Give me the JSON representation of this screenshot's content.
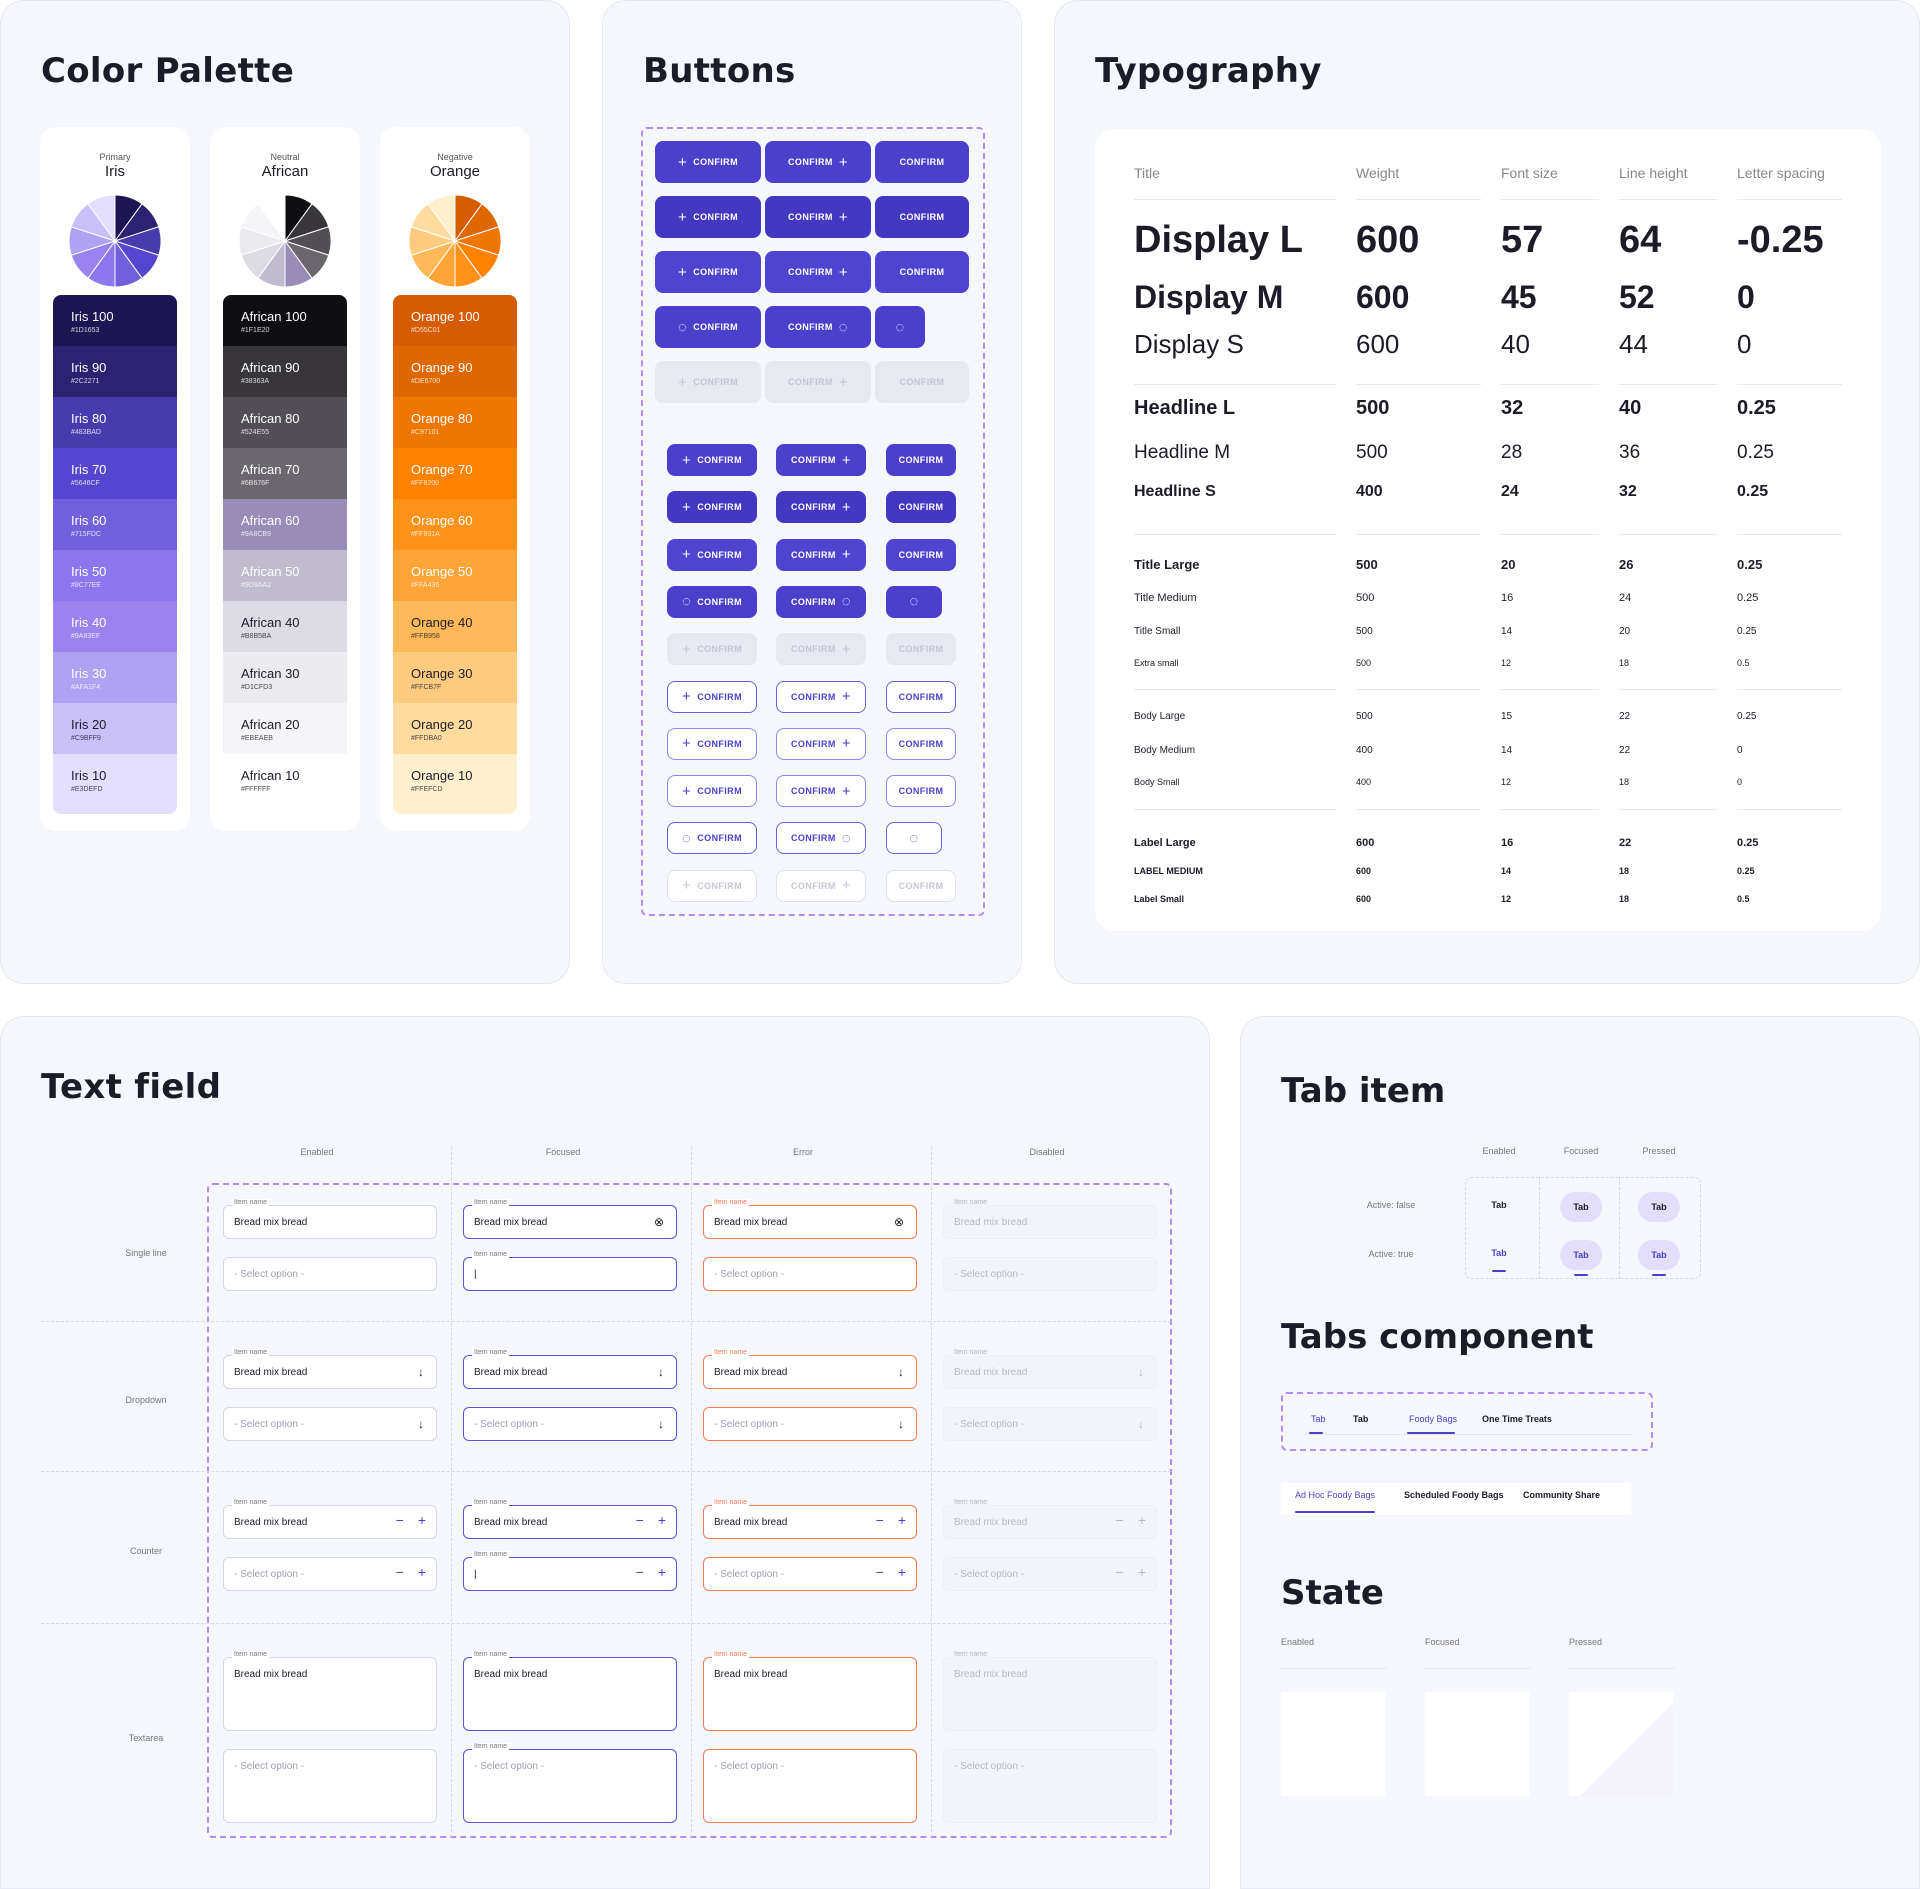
{
  "colors": {
    "accent": "#4b3fcc",
    "error": "#f27c57",
    "disabled": "#e8e8f0",
    "border_dashed": "#b68cf0"
  },
  "palette": {
    "title": "Color Palette",
    "groups": [
      {
        "sub": "Primary",
        "name": "Iris",
        "swatches": [
          {
            "label": "Iris 100",
            "hex": "#1D1653",
            "bg": "#1d1653",
            "fg": "#fff"
          },
          {
            "label": "Iris 90",
            "hex": "#2C2271",
            "bg": "#2c2271",
            "fg": "#fff"
          },
          {
            "label": "Iris 80",
            "hex": "#483BAD",
            "bg": "#483bad",
            "fg": "#fff"
          },
          {
            "label": "Iris 70",
            "hex": "#5646CF",
            "bg": "#5646cf",
            "fg": "#fff"
          },
          {
            "label": "Iris 60",
            "hex": "#715FDC",
            "bg": "#715fdc",
            "fg": "#fff"
          },
          {
            "label": "Iris 50",
            "hex": "#8C77EE",
            "bg": "#8c77ee",
            "fg": "#fff"
          },
          {
            "label": "Iris 40",
            "hex": "#9A83EF",
            "bg": "#9a83ef",
            "fg": "#fff"
          },
          {
            "label": "Iris 30",
            "hex": "#AFA1F4",
            "bg": "#afa1f4",
            "fg": "#fff"
          },
          {
            "label": "Iris 20",
            "hex": "#C9BFF9",
            "bg": "#c9bff9",
            "fg": "#1c1c28"
          },
          {
            "label": "Iris 10",
            "hex": "#E3DEFD",
            "bg": "#e3defd",
            "fg": "#1c1c28"
          }
        ]
      },
      {
        "sub": "Neutral",
        "name": "African",
        "swatches": [
          {
            "label": "African 100",
            "hex": "#1F1E20",
            "bg": "#0f0e12",
            "fg": "#fff"
          },
          {
            "label": "African 90",
            "hex": "#38363A",
            "bg": "#38363a",
            "fg": "#fff"
          },
          {
            "label": "African 80",
            "hex": "#524E55",
            "bg": "#524e55",
            "fg": "#fff"
          },
          {
            "label": "African 70",
            "hex": "#6B676F",
            "bg": "#6b676f",
            "fg": "#fff"
          },
          {
            "label": "African 60",
            "hex": "#9A8CB9",
            "bg": "#9a8cb9",
            "fg": "#fff"
          },
          {
            "label": "African 50",
            "hex": "#9D9AA2",
            "bg": "#c0bccd",
            "fg": "#fff"
          },
          {
            "label": "African 40",
            "hex": "#B8B5BA",
            "bg": "#dddbe3",
            "fg": "#1c1c28"
          },
          {
            "label": "African 30",
            "hex": "#D1CFD3",
            "bg": "#ebeaef",
            "fg": "#1c1c28"
          },
          {
            "label": "African 20",
            "hex": "#EBEAEB",
            "bg": "#f5f5f8",
            "fg": "#1c1c28"
          },
          {
            "label": "African 10",
            "hex": "#FFFFFF",
            "bg": "#ffffff",
            "fg": "#1c1c28"
          }
        ]
      },
      {
        "sub": "Negative",
        "name": "Orange",
        "swatches": [
          {
            "label": "Orange 100",
            "hex": "#D55C01",
            "bg": "#d55c01",
            "fg": "#fff"
          },
          {
            "label": "Orange 90",
            "hex": "#DE6700",
            "bg": "#de6700",
            "fg": "#fff"
          },
          {
            "label": "Orange 80",
            "hex": "#C97101",
            "bg": "#ef7601",
            "fg": "#fff"
          },
          {
            "label": "Orange 70",
            "hex": "#FF8200",
            "bg": "#ff8200",
            "fg": "#fff"
          },
          {
            "label": "Orange 60",
            "hex": "#FF931A",
            "bg": "#ff931a",
            "fg": "#fff"
          },
          {
            "label": "Orange 50",
            "hex": "#FFA436",
            "bg": "#ffa436",
            "fg": "#fff"
          },
          {
            "label": "Orange 40",
            "hex": "#FFB958",
            "bg": "#ffb958",
            "fg": "#1c1c28"
          },
          {
            "label": "Orange 30",
            "hex": "#FFCB7F",
            "bg": "#ffcb7f",
            "fg": "#1c1c28"
          },
          {
            "label": "Orange 20",
            "hex": "#FFDBA0",
            "bg": "#ffdba0",
            "fg": "#1c1c28"
          },
          {
            "label": "Orange 10",
            "hex": "#FFEFCD",
            "bg": "#ffefcd",
            "fg": "#1c1c28"
          }
        ]
      }
    ]
  },
  "buttons": {
    "title": "Buttons",
    "label": "CONFIRM",
    "plus_icon": "+",
    "spinner_icon": "spinner-icon"
  },
  "typography": {
    "title": "Typography",
    "headers": [
      "Title",
      "Weight",
      "Font size",
      "Line height",
      "Letter spacing"
    ],
    "rows": [
      {
        "name": "Display L",
        "weight": "600",
        "size": "57",
        "line": "64",
        "spacing": "-0.25"
      },
      {
        "name": "Display M",
        "weight": "600",
        "size": "45",
        "line": "52",
        "spacing": "0"
      },
      {
        "name": "Display S",
        "weight": "600",
        "size": "40",
        "line": "44",
        "spacing": "0"
      },
      {
        "name": "Headline L",
        "weight": "500",
        "size": "32",
        "line": "40",
        "spacing": "0.25"
      },
      {
        "name": "Headline M",
        "weight": "500",
        "size": "28",
        "line": "36",
        "spacing": "0.25"
      },
      {
        "name": "Headline S",
        "weight": "400",
        "size": "24",
        "line": "32",
        "spacing": "0.25"
      },
      {
        "name": "Title Large",
        "weight": "500",
        "size": "20",
        "line": "26",
        "spacing": "0.25"
      },
      {
        "name": "Title Medium",
        "weight": "500",
        "size": "16",
        "line": "24",
        "spacing": "0.25"
      },
      {
        "name": "Title Small",
        "weight": "500",
        "size": "14",
        "line": "20",
        "spacing": "0.25"
      },
      {
        "name": "Extra small",
        "weight": "500",
        "size": "12",
        "line": "18",
        "spacing": "0.5"
      },
      {
        "name": "Body Large",
        "weight": "500",
        "size": "15",
        "line": "22",
        "spacing": "0.25"
      },
      {
        "name": "Body Medium",
        "weight": "400",
        "size": "14",
        "line": "22",
        "spacing": "0"
      },
      {
        "name": "Body Small",
        "weight": "400",
        "size": "12",
        "line": "18",
        "spacing": "0"
      },
      {
        "name": "Label Large",
        "weight": "600",
        "size": "16",
        "line": "22",
        "spacing": "0.25"
      },
      {
        "name": "LABEL MEDIUM",
        "weight": "600",
        "size": "14",
        "line": "18",
        "spacing": "0.25"
      },
      {
        "name": "Label Small",
        "weight": "600",
        "size": "12",
        "line": "18",
        "spacing": "0.5"
      }
    ]
  },
  "textfield": {
    "title": "Text field",
    "columns": [
      "Enabled",
      "Focused",
      "Error",
      "Disabled"
    ],
    "rows": [
      "Single line",
      "Dropdown",
      "Counter",
      "Textarea"
    ],
    "item_label": "Item name",
    "value": "Bread mix bread",
    "placeholder": "- Select option -",
    "clear_icon": "⊗",
    "arrow_icon": "↓",
    "minus": "−",
    "plus": "+"
  },
  "tabitem": {
    "title": "Tab item",
    "columns": [
      "Enabled",
      "Focused",
      "Pressed"
    ],
    "rows": [
      "Active: false",
      "Active: true"
    ],
    "tab_label": "Tab"
  },
  "tabs_component": {
    "title": "Tabs component",
    "row1": [
      "Tab",
      "Tab",
      "Foody Bags",
      "One Time Treats"
    ],
    "row2": [
      "Ad Hoc Foody Bags",
      "Scheduled Foody Bags",
      "Community Share"
    ]
  },
  "state": {
    "title": "State",
    "labels": [
      "Enabled",
      "Focused",
      "Pressed"
    ]
  }
}
